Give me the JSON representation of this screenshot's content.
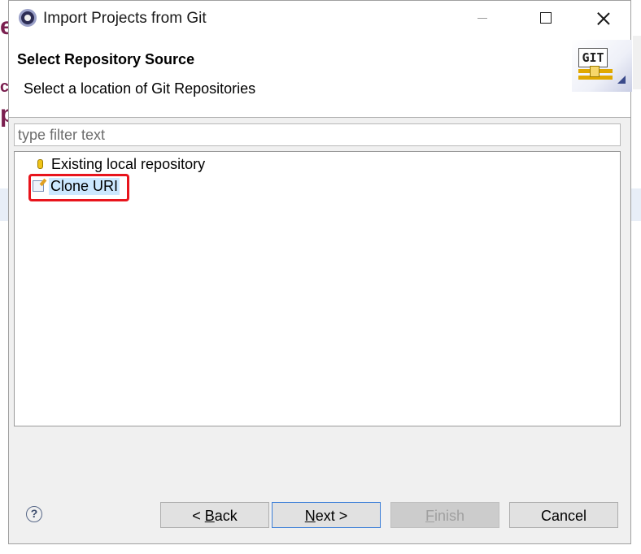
{
  "window": {
    "title": "Import Projects from Git"
  },
  "header": {
    "title": "Select Repository Source",
    "description": "Select a location of Git Repositories",
    "logo_text": "GIT"
  },
  "filter": {
    "placeholder": "type filter text"
  },
  "tree": {
    "items": [
      {
        "label": "Existing local repository",
        "icon": "repository-icon"
      },
      {
        "label": "Clone URI",
        "icon": "clone-icon",
        "selected": true
      }
    ]
  },
  "buttons": {
    "back_prefix": "< ",
    "back_mnemonic": "B",
    "back_rest": "ack",
    "next_mnemonic": "N",
    "next_rest": "ext >",
    "finish_mnemonic": "F",
    "finish_rest": "inish",
    "cancel": "Cancel",
    "help": "?"
  },
  "colors": {
    "highlight": "#e8141c",
    "selection": "#cce8ff",
    "default_button_border": "#3c7fd8"
  }
}
